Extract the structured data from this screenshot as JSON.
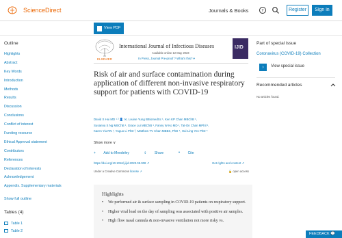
{
  "header": {
    "brand": "ScienceDirect",
    "journals_books": "Journals & Books",
    "register": "Register",
    "sign_in": "Sign in"
  },
  "toolbar": {
    "view_pdf": "View PDF"
  },
  "outline": {
    "title": "Outline",
    "items": [
      "Highlights",
      "Abstract",
      "Key Words",
      "Introduction",
      "Methods",
      "Results",
      "Discussion",
      "Conclusions",
      "Conflict of interest",
      "Funding resource",
      "Ethical Approval statement",
      "Contributors",
      "References",
      "Declaration of interests",
      "Acknowledgement",
      "Appendix. Supplementary materials"
    ],
    "show_full": "Show full outline",
    "tables_title": "Tables (4)",
    "tables": [
      "Table 1",
      "Table 2"
    ]
  },
  "journal": {
    "title": "International Journal of Infectious Diseases",
    "available": "Available online 12 May 2023",
    "links": "In Press, Journal Pre-proof   ?   What's this? ▾",
    "cover_text": "IJID"
  },
  "article": {
    "title": "Risk of air and surface contamination during application of different non-invasive respiratory support for patients with COVID-19",
    "authors": [
      "David S Hui MD ¹ ² ",
      "Louise Yung BBiomedSc ¹, Ken KP Chan MBChB ¹,",
      "Susanna S Ng MBChB ¹, Grace Lui MBChB ¹, Fanny W Ko MD ¹, Tat-On Chan MPhil ¹,",
      "Karen Yiu RN ¹, Yuguo Li PhD ³, Matthew TV Chan MBBS, PhD ⁴, Hui-Ling Yen PhD ⁵"
    ],
    "show_more": "Show more ∨",
    "add_mendeley": "Add to Mendeley",
    "share": "Share",
    "cite": "Cite",
    "doi": "https://doi.org/10.1016/j.ijid.2023.05.008 ↗",
    "rights": "Get rights and content ↗",
    "license_prefix": "Under a Creative Commons ",
    "license_link": "license ↗",
    "open_access": "open access"
  },
  "highlights": {
    "title": "Highlights",
    "items": [
      "We performed air & surface sampling in COVID-19 patients on respiratory support.",
      "Higher viral load on the day of sampling was associated with positive air samples.",
      "High flow nasal cannula & non-invasive ventilation not more risky vs."
    ]
  },
  "right": {
    "part_title": "Part of special issue",
    "part_link": "Coronavirus (COVID-19) Collection",
    "view_special": "View special issue",
    "rec_title": "Recommended articles",
    "no_articles": "No articles found."
  },
  "feedback": "FEEDBACK 💬",
  "colors": {
    "brand": "#eb6500",
    "link": "#0c7dbb",
    "highlight_bg": "#f5f5f5"
  }
}
